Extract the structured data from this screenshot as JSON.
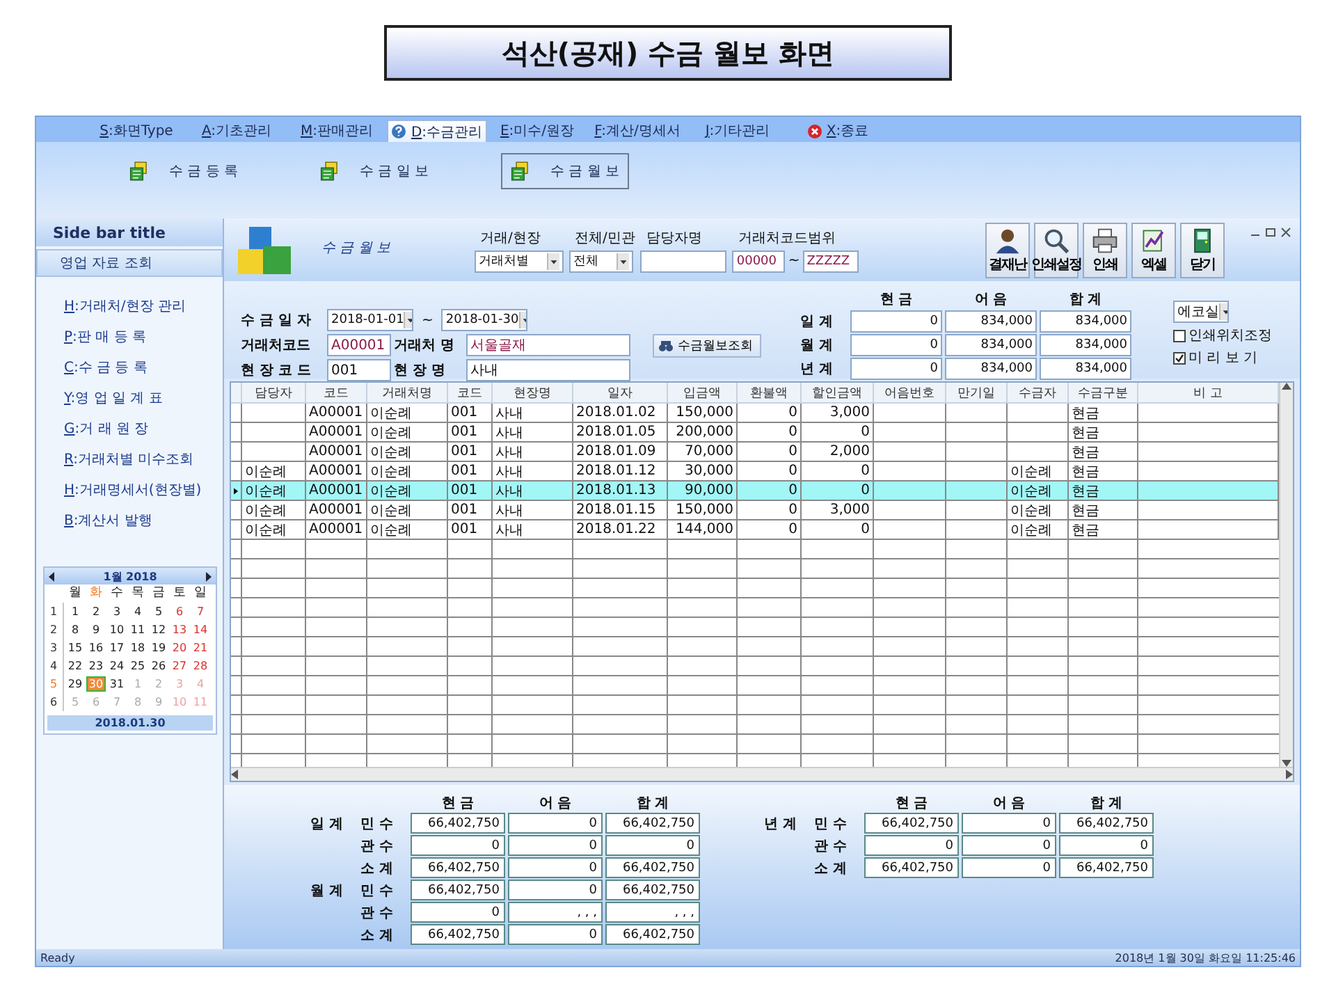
{
  "slide_title": "석산(공재) 수금 월보 화면",
  "menu_tabs": [
    {
      "label": "S:화면Type",
      "selected": false,
      "kind": "plain"
    },
    {
      "label": "A:기초관리",
      "selected": false,
      "kind": "plain"
    },
    {
      "label": "M:판매관리",
      "selected": false,
      "kind": "plain"
    },
    {
      "label": "D:수금관리",
      "selected": true,
      "kind": "help"
    },
    {
      "label": "E:미수/원장",
      "selected": false,
      "kind": "plain"
    },
    {
      "label": "F:계산/명세서",
      "selected": false,
      "kind": "plain"
    },
    {
      "label": "J:기타관리",
      "selected": false,
      "kind": "plain"
    },
    {
      "label": "X:종료",
      "selected": false,
      "kind": "exit"
    }
  ],
  "ribbon": [
    {
      "label": "수 금 등 록",
      "selected": false
    },
    {
      "label": "수 금 일 보",
      "selected": false
    },
    {
      "label": "수 금 월 보",
      "selected": true
    }
  ],
  "sidebar": {
    "title": "Side bar title",
    "section": "영업 자료 조회",
    "items": [
      "H:거래처/현장 관리",
      "P:판 매 등 록",
      "C:수 금 등 록",
      "Y:영 업 일 계 표",
      "G:거 래 원 장",
      "R:거래처별 미수조회",
      "H:거래명세서(현장별)",
      "B:계산서 발행"
    ]
  },
  "calendar": {
    "month": "1월 2018",
    "weekdays": [
      {
        "label": "월",
        "selected": false
      },
      {
        "label": "화",
        "selected": true
      },
      {
        "label": "수",
        "selected": false
      },
      {
        "label": "목",
        "selected": false
      },
      {
        "label": "금",
        "selected": false
      },
      {
        "label": "토",
        "selected": false
      },
      {
        "label": "일",
        "selected": false
      }
    ],
    "weeks": [
      {
        "number": "1",
        "current": false,
        "days": [
          {
            "day": "1",
            "kind": "in",
            "selected": false
          },
          {
            "day": "2",
            "kind": "in",
            "selected": false
          },
          {
            "day": "3",
            "kind": "in",
            "selected": false
          },
          {
            "day": "4",
            "kind": "in",
            "selected": false
          },
          {
            "day": "5",
            "kind": "in",
            "selected": false
          },
          {
            "day": "6",
            "kind": "weekend",
            "selected": false
          },
          {
            "day": "7",
            "kind": "weekend",
            "selected": false
          }
        ]
      },
      {
        "number": "2",
        "current": false,
        "days": [
          {
            "day": "8",
            "kind": "in",
            "selected": false
          },
          {
            "day": "9",
            "kind": "in",
            "selected": false
          },
          {
            "day": "10",
            "kind": "in",
            "selected": false
          },
          {
            "day": "11",
            "kind": "in",
            "selected": false
          },
          {
            "day": "12",
            "kind": "in",
            "selected": false
          },
          {
            "day": "13",
            "kind": "weekend",
            "selected": false
          },
          {
            "day": "14",
            "kind": "weekend",
            "selected": false
          }
        ]
      },
      {
        "number": "3",
        "current": false,
        "days": [
          {
            "day": "15",
            "kind": "in",
            "selected": false
          },
          {
            "day": "16",
            "kind": "in",
            "selected": false
          },
          {
            "day": "17",
            "kind": "in",
            "selected": false
          },
          {
            "day": "18",
            "kind": "in",
            "selected": false
          },
          {
            "day": "19",
            "kind": "in",
            "selected": false
          },
          {
            "day": "20",
            "kind": "weekend",
            "selected": false
          },
          {
            "day": "21",
            "kind": "weekend",
            "selected": false
          }
        ]
      },
      {
        "number": "4",
        "current": false,
        "days": [
          {
            "day": "22",
            "kind": "in",
            "selected": false
          },
          {
            "day": "23",
            "kind": "in",
            "selected": false
          },
          {
            "day": "24",
            "kind": "in",
            "selected": false
          },
          {
            "day": "25",
            "kind": "in",
            "selected": false
          },
          {
            "day": "26",
            "kind": "in",
            "selected": false
          },
          {
            "day": "27",
            "kind": "weekend",
            "selected": false
          },
          {
            "day": "28",
            "kind": "weekend",
            "selected": false
          }
        ]
      },
      {
        "number": "5",
        "current": true,
        "days": [
          {
            "day": "29",
            "kind": "in",
            "selected": false
          },
          {
            "day": "30",
            "kind": "in",
            "selected": true
          },
          {
            "day": "31",
            "kind": "in",
            "selected": false
          },
          {
            "day": "1",
            "kind": "out",
            "selected": false
          },
          {
            "day": "2",
            "kind": "out",
            "selected": false
          },
          {
            "day": "3",
            "kind": "out-weekend",
            "selected": false
          },
          {
            "day": "4",
            "kind": "out-weekend",
            "selected": false
          }
        ]
      },
      {
        "number": "6",
        "current": false,
        "days": [
          {
            "day": "5",
            "kind": "out",
            "selected": false
          },
          {
            "day": "6",
            "kind": "out",
            "selected": false
          },
          {
            "day": "7",
            "kind": "out",
            "selected": false
          },
          {
            "day": "8",
            "kind": "out",
            "selected": false
          },
          {
            "day": "9",
            "kind": "out",
            "selected": false
          },
          {
            "day": "10",
            "kind": "out-weekend",
            "selected": false
          },
          {
            "day": "11",
            "kind": "out-weekend",
            "selected": false
          }
        ]
      }
    ],
    "today": "2018.01.30"
  },
  "header": {
    "title": "수 금 월 보",
    "filters": [
      {
        "label": "거래/현장",
        "value": "거래처별",
        "kind": "select"
      },
      {
        "label": "전체/민관",
        "value": "전체",
        "kind": "select"
      },
      {
        "label": "담당자명",
        "kind": "text"
      }
    ],
    "range": {
      "label": "거래처코드범위",
      "from": "00000",
      "separator": "~",
      "to": "ZZZZZ"
    },
    "toolbar": [
      {
        "label": "결재난",
        "kind": "person"
      },
      {
        "label": "인쇄설정",
        "kind": "search"
      },
      {
        "label": "인쇄",
        "kind": "printer"
      },
      {
        "label": "엑셀",
        "kind": "chart"
      },
      {
        "label": "닫기",
        "kind": "door"
      }
    ]
  },
  "query": {
    "date_label": "수 금 일 자",
    "date_from": "2018-01-01",
    "date_separator": "~",
    "date_to": "2018-01-30",
    "client_code_label": "거래처코드",
    "client_code": "A00001",
    "client_name_label": "거래처 명",
    "client_name": "서울골재",
    "site_code_label": "현 장 코 드",
    "site_code": "001",
    "site_name_label": "현 장 명",
    "site_name": "사내",
    "search_button": "수금월보조회"
  },
  "totals": {
    "columns": [
      "현 금",
      "어 음",
      "합 계"
    ],
    "rows": [
      {
        "label": "일 계",
        "values": [
          "0",
          "834,000",
          "834,000"
        ]
      },
      {
        "label": "월 계",
        "values": [
          "0",
          "834,000",
          "834,000"
        ]
      },
      {
        "label": "년 계",
        "values": [
          "0",
          "834,000",
          "834,000"
        ]
      }
    ]
  },
  "options": {
    "select": "에코실",
    "checkboxes": [
      {
        "label": "인쇄위치조정",
        "checked": false
      },
      {
        "label": "미 리 보 기",
        "checked": true
      }
    ]
  },
  "grid": {
    "columns": [
      "담당자",
      "코드",
      "거래처명",
      "코드",
      "현장명",
      "일자",
      "입금액",
      "환불액",
      "할인금액",
      "어음번호",
      "만기일",
      "수금자",
      "수금구분",
      "비  고"
    ],
    "rows": [
      {
        "selected": false,
        "cells": [
          null,
          "A00001",
          "이순례",
          "001",
          "사내",
          "2018.01.02",
          "150,000",
          "0",
          "3,000",
          null,
          null,
          null,
          "현금",
          null
        ]
      },
      {
        "selected": false,
        "cells": [
          null,
          "A00001",
          "이순례",
          "001",
          "사내",
          "2018.01.05",
          "200,000",
          "0",
          "0",
          null,
          null,
          null,
          "현금",
          null
        ]
      },
      {
        "selected": false,
        "cells": [
          null,
          "A00001",
          "이순례",
          "001",
          "사내",
          "2018.01.09",
          "70,000",
          "0",
          "2,000",
          null,
          null,
          null,
          "현금",
          null
        ]
      },
      {
        "selected": false,
        "cells": [
          "이순례",
          "A00001",
          "이순례",
          "001",
          "사내",
          "2018.01.12",
          "30,000",
          "0",
          "0",
          null,
          null,
          "이순례",
          "현금",
          null
        ]
      },
      {
        "selected": true,
        "cells": [
          "이순례",
          "A00001",
          "이순례",
          "001",
          "사내",
          "2018.01.13",
          "90,000",
          "0",
          "0",
          null,
          null,
          "이순례",
          "현금",
          null
        ]
      },
      {
        "selected": false,
        "cells": [
          "이순례",
          "A00001",
          "이순례",
          "001",
          "사내",
          "2018.01.15",
          "150,000",
          "0",
          "3,000",
          null,
          null,
          "이순례",
          "현금",
          null
        ]
      },
      {
        "selected": false,
        "cells": [
          "이순례",
          "A00001",
          "이순례",
          "001",
          "사내",
          "2018.01.22",
          "144,000",
          "0",
          "0",
          null,
          null,
          "이순례",
          "현금",
          null
        ]
      }
    ]
  },
  "summary": {
    "left": {
      "columns": [
        "현 금",
        "어 음",
        "합 계"
      ],
      "sections": [
        {
          "label": "일 계",
          "rows": [
            {
              "label": "민 수",
              "values": [
                "66,402,750",
                "0",
                "66,402,750"
              ]
            },
            {
              "label": "관 수",
              "values": [
                "0",
                "0",
                "0"
              ]
            },
            {
              "label": "소 계",
              "values": [
                "66,402,750",
                "0",
                "66,402,750"
              ]
            }
          ]
        },
        {
          "label": "월 계",
          "rows": [
            {
              "label": "민 수",
              "values": [
                "66,402,750",
                "0",
                "66,402,750"
              ]
            },
            {
              "label": "관 수",
              "values": [
                "0",
                ", , ,",
                ", , ,"
              ]
            },
            {
              "label": "소 계",
              "values": [
                "66,402,750",
                "0",
                "66,402,750"
              ]
            }
          ]
        }
      ]
    },
    "right": {
      "columns": [
        "현 금",
        "어 음",
        "합 계"
      ],
      "sections": [
        {
          "label": "년 계",
          "rows": [
            {
              "label": "민 수",
              "values": [
                "66,402,750",
                "0",
                "66,402,750"
              ]
            },
            {
              "label": "관 수",
              "values": [
                "0",
                "0",
                "0"
              ]
            },
            {
              "label": "소 계",
              "values": [
                "66,402,750",
                "0",
                "66,402,750"
              ]
            }
          ]
        }
      ]
    }
  },
  "status": {
    "left": "Ready",
    "right": "2018년 1월 30일 화요일 11:25:46"
  }
}
